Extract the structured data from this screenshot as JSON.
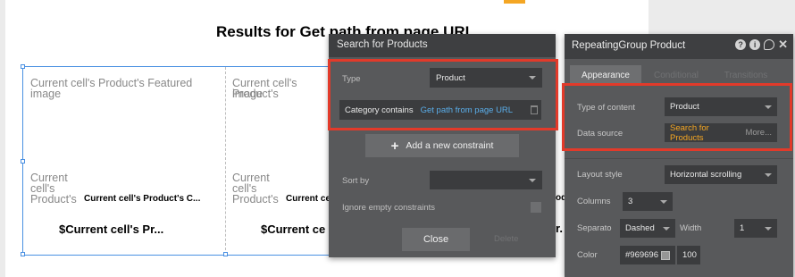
{
  "canvas": {
    "title": "Results for Get path from page URL",
    "cells": [
      {
        "image_text": "Current cell's Product's Featured image",
        "name_wrap": [
          "Current",
          "cell's",
          "Product's"
        ],
        "bold_text": "Current cell's Product's C...",
        "price_text": "$Current cell's Pr..."
      },
      {
        "image_text": "Current cell's Product's",
        "name_wrap": [
          "Current",
          "cell's",
          "Product's"
        ],
        "bold_text": "Current cel",
        "price_text": "$Current ce"
      }
    ],
    "overflow_bold": "od",
    "overflow_price": "r."
  },
  "search_panel": {
    "title": "Search for Products",
    "type_label": "Type",
    "type_value": "Product",
    "constraint_label": "Category contains",
    "constraint_value": "Get path from page URL",
    "add_constraint_label": "Add a new constraint",
    "sort_label": "Sort by",
    "sort_value": "",
    "ignore_empty_label": "Ignore empty constraints",
    "close_label": "Close",
    "delete_label": "Delete"
  },
  "property_panel": {
    "title": "RepeatingGroup Product",
    "tabs": [
      "Appearance",
      "Conditional",
      "Transitions"
    ],
    "type_of_content_label": "Type of content",
    "type_of_content_value": "Product",
    "data_source_label": "Data source",
    "data_source_value": "Search for Products",
    "data_source_more": "More...",
    "layout_style_label": "Layout style",
    "layout_style_value": "Horizontal scrolling",
    "columns_label": "Columns",
    "columns_value": "3",
    "separator_label": "Separato",
    "separator_value": "Dashed",
    "width_label": "Width",
    "width_value": "1",
    "color_label": "Color",
    "color_value": "#969696",
    "opacity_value": "100"
  },
  "colors": {
    "highlight_red": "#e23a2a",
    "link_blue": "#5aaeea",
    "data_source_orange": "#f4a623",
    "selection_blue": "#4a90e2"
  }
}
